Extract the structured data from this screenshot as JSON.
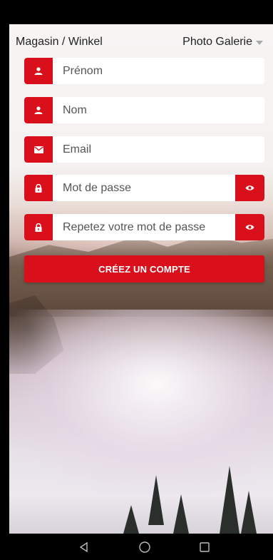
{
  "header": {
    "store_label": "Magasin / Winkel",
    "gallery_label": "Photo Galerie"
  },
  "form": {
    "first_name": {
      "placeholder": "Prénom",
      "icon": "user-icon"
    },
    "last_name": {
      "placeholder": "Nom",
      "icon": "user-icon"
    },
    "email": {
      "placeholder": "Email",
      "icon": "envelope-icon"
    },
    "password": {
      "placeholder": "Mot de passe",
      "icon": "lock-icon",
      "toggle_icon": "eye-icon"
    },
    "password_repeat": {
      "placeholder": "Repetez votre mot de passe",
      "icon": "lock-icon",
      "toggle_icon": "eye-icon"
    },
    "submit_label": "CRÉEZ UN COMPTE"
  },
  "colors": {
    "accent": "#d9101c",
    "field_bg": "#ffffff",
    "text": "#222222"
  },
  "navbar": {
    "icons": [
      "back-icon",
      "home-icon",
      "recents-icon"
    ]
  }
}
